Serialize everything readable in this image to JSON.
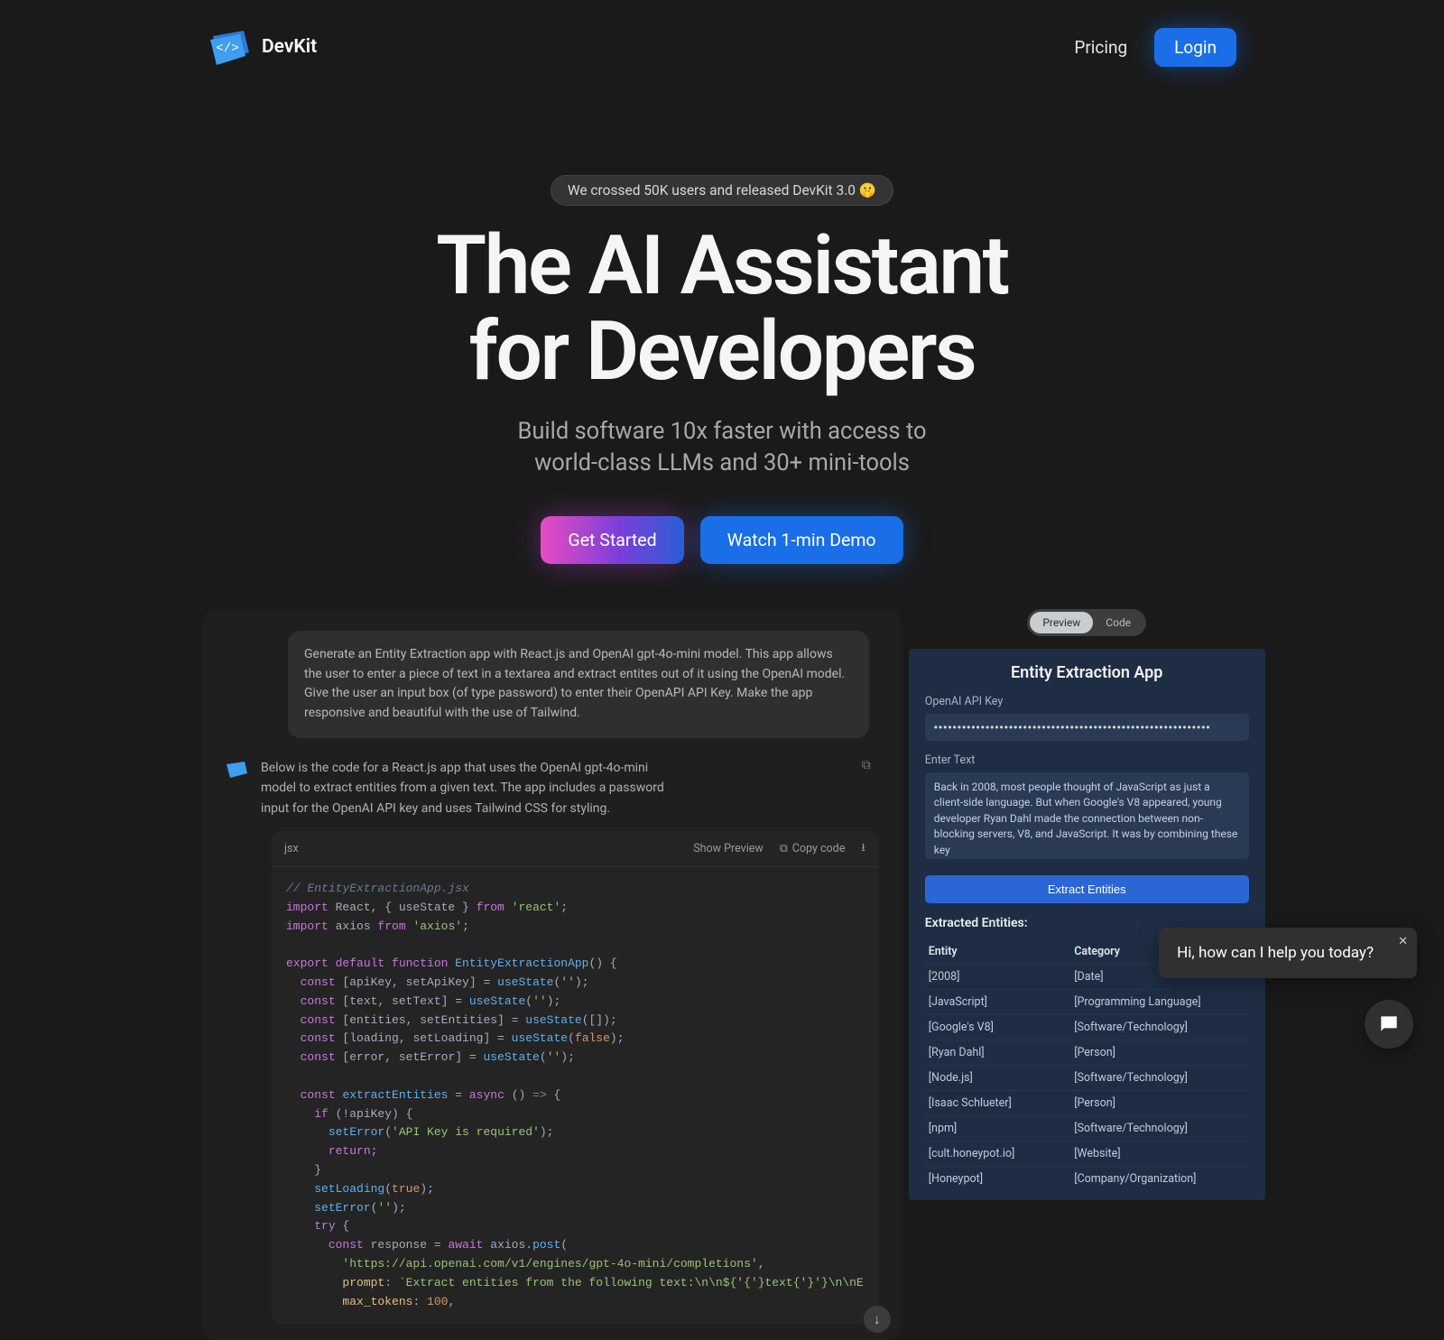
{
  "brand": {
    "name": "DevKit"
  },
  "nav": {
    "pricing": "Pricing",
    "login": "Login"
  },
  "hero": {
    "pill": "We crossed 50K users and released DevKit 3.0 🤫",
    "title_line1": "The AI Assistant",
    "title_line2": "for Developers",
    "subtitle_line1": "Build software 10x faster with access to",
    "subtitle_line2": "world-class LLMs and 30+ mini-tools",
    "cta_primary": "Get Started",
    "cta_secondary": "Watch 1-min Demo"
  },
  "chat": {
    "user_prompt": "Generate an Entity Extraction app with React.js and OpenAI gpt-4o-mini model. This app allows the user to enter a piece of text in a textarea and extract entites out of it using the OpenAI model. Give the user an input box (of type password) to enter their OpenAPI API Key. Make the app responsive and beautiful with the use of Tailwind.",
    "assistant_text": "Below is the code for a React.js app that uses the OpenAI gpt-4o-mini model to extract entities from a given text. The app includes a password input for the OpenAI API key and uses Tailwind CSS for styling.",
    "code_lang": "jsx",
    "code_actions": {
      "show_preview": "Show Preview",
      "copy_code": "Copy code"
    }
  },
  "toggle": {
    "preview": "Preview",
    "code": "Code"
  },
  "app": {
    "title": "Entity Extraction App",
    "api_label": "OpenAI API Key",
    "api_value": "•••••••••••••••••••••••••••••••••••••••••••••••••••••••••••",
    "text_label": "Enter Text",
    "text_value": "Back in 2008, most people thought of JavaScript as just a client-side language. But when Google's V8 appeared, young developer Ryan Dahl made the connection between non-blocking servers, V8, and JavaScript. It was by combining these key",
    "button": "Extract Entities",
    "extracted_heading": "Extracted Entities:",
    "col_entity": "Entity",
    "col_category": "Category",
    "rows": [
      {
        "entity": "[2008]",
        "category": "[Date]"
      },
      {
        "entity": "[JavaScript]",
        "category": "[Programming Language]"
      },
      {
        "entity": "[Google's V8]",
        "category": "[Software/Technology]"
      },
      {
        "entity": "[Ryan Dahl]",
        "category": "[Person]"
      },
      {
        "entity": "[Node.js]",
        "category": "[Software/Technology]"
      },
      {
        "entity": "[Isaac Schlueter]",
        "category": "[Person]"
      },
      {
        "entity": "[npm]",
        "category": "[Software/Technology]"
      },
      {
        "entity": "[cult.honeypot.io]",
        "category": "[Website]"
      },
      {
        "entity": "[Honeypot]",
        "category": "[Company/Organization]"
      }
    ]
  },
  "help": {
    "message": "Hi, how can I help you today?"
  }
}
